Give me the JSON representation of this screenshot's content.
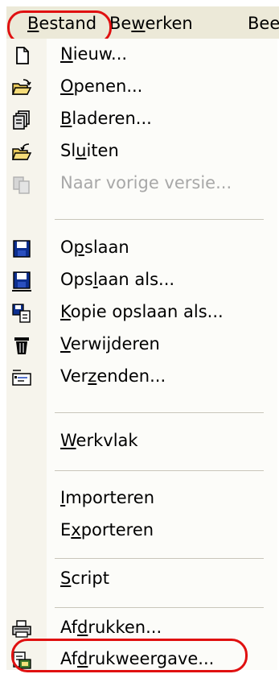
{
  "menubar": {
    "items": [
      {
        "pre": "",
        "acc": "B",
        "post": "estand"
      },
      {
        "pre": "Be",
        "acc": "w",
        "post": "erken"
      },
      {
        "pre": "Bee",
        "acc": "",
        "post": ""
      }
    ]
  },
  "menu": {
    "items": [
      {
        "pre": "",
        "acc": "N",
        "post": "ieuw...",
        "icon": "new-document-icon",
        "disabled": false
      },
      {
        "pre": "",
        "acc": "O",
        "post": "penen...",
        "icon": "open-folder-icon",
        "disabled": false
      },
      {
        "pre": "",
        "acc": "B",
        "post": "laderen...",
        "icon": "browse-icon",
        "disabled": false
      },
      {
        "pre": "Sl",
        "acc": "u",
        "post": "iten",
        "icon": "close-folder-icon",
        "disabled": false
      },
      {
        "pre": "Naar vorige versie...",
        "acc": "",
        "post": "",
        "icon": "revert-icon",
        "disabled": true
      },
      {
        "pre": "O",
        "acc": "p",
        "post": "slaan",
        "icon": "save-icon",
        "disabled": false
      },
      {
        "pre": "Ops",
        "acc": "l",
        "post": "aan als...",
        "icon": "save-as-icon",
        "disabled": false
      },
      {
        "pre": "",
        "acc": "K",
        "post": "opie opslaan als...",
        "icon": "save-copy-icon",
        "disabled": false
      },
      {
        "pre": "",
        "acc": "V",
        "post": "erwijderen",
        "icon": "trash-icon",
        "disabled": false
      },
      {
        "pre": "Ver",
        "acc": "z",
        "post": "enden...",
        "icon": "send-icon",
        "disabled": false
      },
      {
        "pre": "",
        "acc": "W",
        "post": "erkvlak",
        "icon": "",
        "disabled": false
      },
      {
        "pre": "",
        "acc": "I",
        "post": "mporteren",
        "icon": "",
        "disabled": false
      },
      {
        "pre": "E",
        "acc": "x",
        "post": "porteren",
        "icon": "",
        "disabled": false
      },
      {
        "pre": "",
        "acc": "S",
        "post": "cript",
        "icon": "",
        "disabled": false
      },
      {
        "pre": "Af",
        "acc": "d",
        "post": "rukken...",
        "icon": "printer-icon",
        "disabled": false
      },
      {
        "pre": "Af",
        "acc": "d",
        "post": "rukweergave...",
        "icon": "print-preview-icon",
        "disabled": false
      }
    ]
  }
}
